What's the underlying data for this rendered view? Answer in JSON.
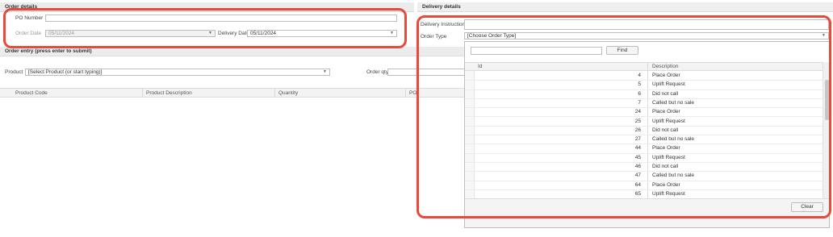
{
  "order_details": {
    "title": "Order details",
    "po_number_label": "PO Number",
    "po_number_value": "",
    "order_date_label": "Order Date",
    "order_date_value": "05/11/2024",
    "delivery_date_label": "Delivery Date",
    "delivery_date_value": "05/11/2024"
  },
  "order_entry": {
    "title": "Order entry (press enter to submit)",
    "product_label": "Product",
    "product_placeholder": "[Select Product (or start typing)]",
    "order_qty_label": "Order qty"
  },
  "grid": {
    "columns": [
      "Product Code",
      "Product Description",
      "Quantity",
      "PO"
    ]
  },
  "delivery_details": {
    "title": "Delivery details",
    "instructions_label": "Delivery Instructions",
    "instructions_value": "",
    "order_type_label": "Order Type",
    "order_type_placeholder": "[Choose Order Type]"
  },
  "dropdown": {
    "search_value": "",
    "find_label": "Find",
    "columns": [
      "Id",
      "Description"
    ],
    "rows": [
      {
        "id": "4",
        "desc": "Place Order"
      },
      {
        "id": "5",
        "desc": "Uplift Request"
      },
      {
        "id": "6",
        "desc": "Did not call"
      },
      {
        "id": "7",
        "desc": "Called but no sale"
      },
      {
        "id": "24",
        "desc": "Place Order"
      },
      {
        "id": "25",
        "desc": "Uplift Request"
      },
      {
        "id": "26",
        "desc": "Did not call"
      },
      {
        "id": "27",
        "desc": "Called but no sale"
      },
      {
        "id": "44",
        "desc": "Place Order"
      },
      {
        "id": "45",
        "desc": "Uplift Request"
      },
      {
        "id": "46",
        "desc": "Did not call"
      },
      {
        "id": "47",
        "desc": "Called but no sale"
      },
      {
        "id": "64",
        "desc": "Place Order"
      },
      {
        "id": "65",
        "desc": "Uplift Request"
      }
    ],
    "clear_label": "Clear"
  },
  "colors": {
    "annotation": "#e8493b",
    "header_bg": "#ececec"
  }
}
